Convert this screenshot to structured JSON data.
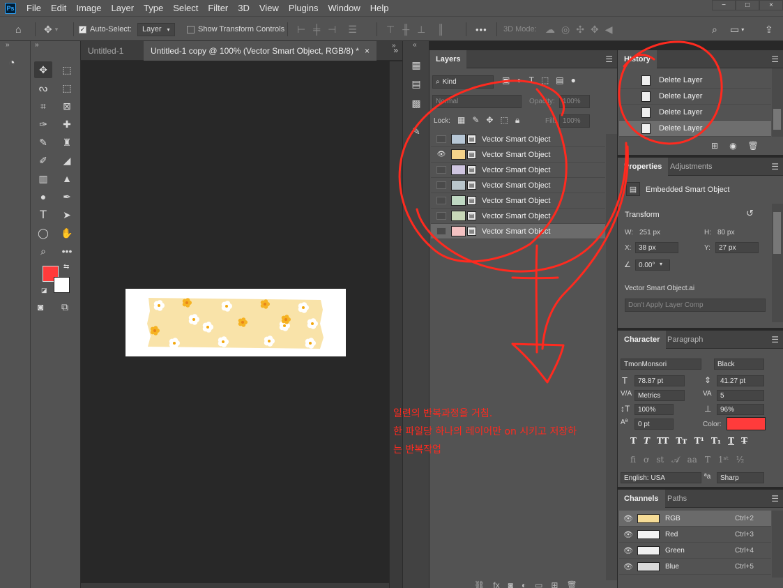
{
  "app": {
    "logo": "Ps"
  },
  "menu": [
    "File",
    "Edit",
    "Image",
    "Layer",
    "Type",
    "Select",
    "Filter",
    "3D",
    "View",
    "Plugins",
    "Window",
    "Help"
  ],
  "window_controls": {
    "minimize": "−",
    "maximize": "□",
    "close": "×"
  },
  "options": {
    "auto_select_label": "Auto-Select:",
    "auto_select_checked": true,
    "auto_select_value": "Layer",
    "show_transform_label": "Show Transform Controls",
    "show_transform_checked": false,
    "mode_3d_label": "3D Mode:",
    "more": "•••"
  },
  "document": {
    "tabs": [
      {
        "label": "Untitled-1",
        "active": false
      },
      {
        "label": "Untitled-1 copy @ 100% (Vector Smart Object, RGB/8) *",
        "active": true
      }
    ],
    "close_glyph": "×",
    "overflow": "»"
  },
  "layers_panel": {
    "tab": "Layers",
    "filter_kind": "Kind",
    "blend_mode": "Normal",
    "opacity_label": "Opacity:",
    "opacity_value": "100%",
    "lock_label": "Lock:",
    "fill_label": "Fill:",
    "fill_value": "100%",
    "layers": [
      {
        "name": "Vector Smart Object",
        "visible": false,
        "selected": false
      },
      {
        "name": "Vector Smart Object",
        "visible": true,
        "selected": false
      },
      {
        "name": "Vector Smart Object",
        "visible": false,
        "selected": false
      },
      {
        "name": "Vector Smart Object",
        "visible": false,
        "selected": false
      },
      {
        "name": "Vector Smart Object",
        "visible": false,
        "selected": false
      },
      {
        "name": "Vector Smart Object",
        "visible": false,
        "selected": false
      },
      {
        "name": "Vector Smart Object",
        "visible": false,
        "selected": true
      }
    ]
  },
  "history_panel": {
    "tab": "History",
    "items": [
      "Delete Layer",
      "Delete Layer",
      "Delete Layer",
      "Delete Layer"
    ]
  },
  "properties_panel": {
    "tabs": [
      "Properties",
      "Adjustments"
    ],
    "type_label": "Embedded Smart Object",
    "transform_label": "Transform",
    "w_label": "W:",
    "w_value": "251 px",
    "h_label": "H:",
    "h_value": "80 px",
    "x_label": "X:",
    "x_value": "38 px",
    "y_label": "Y:",
    "y_value": "27 px",
    "angle_value": "0.00°",
    "file_name": "Vector Smart Object.ai",
    "layer_comp": "Don't Apply Layer Comp"
  },
  "character_panel": {
    "tabs": [
      "Character",
      "Paragraph"
    ],
    "font_family": "TmonMonsori",
    "font_style": "Black",
    "font_size": "78.87 pt",
    "leading": "41.27 pt",
    "kerning": "Metrics",
    "tracking": "5",
    "vertical_scale": "100%",
    "horizontal_scale": "96%",
    "baseline_shift": "0 pt",
    "color_label": "Color:",
    "color_value": "#ff3b3b",
    "language": "English: USA",
    "aa_label": "ªa",
    "antialias": "Sharp"
  },
  "channels_panel": {
    "tabs": [
      "Channels",
      "Paths"
    ],
    "channels": [
      {
        "name": "RGB",
        "shortcut": "Ctrl+2"
      },
      {
        "name": "Red",
        "shortcut": "Ctrl+3"
      },
      {
        "name": "Green",
        "shortcut": "Ctrl+4"
      },
      {
        "name": "Blue",
        "shortcut": "Ctrl+5"
      }
    ]
  },
  "annotation": {
    "color": "#ff2a1f",
    "lines": [
      "일련의 반복과정을 거침.",
      "한 파일당 하나의 레이어만 on 시키고 저장하",
      "는 반복작업"
    ]
  },
  "colors": {
    "foreground": "#ff3b3b",
    "background": "#ffffff",
    "tape_fill": "#f9e3a9",
    "flower_center": "#f2a80f"
  }
}
